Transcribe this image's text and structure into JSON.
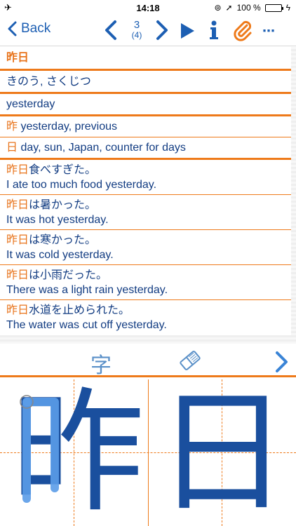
{
  "status": {
    "time": "14:18",
    "battery": "100 %"
  },
  "nav": {
    "back_label": "Back",
    "position": "3",
    "total": "(4)",
    "more": "⋯"
  },
  "entry": {
    "word": "昨日",
    "reading": "きのう, さくじつ",
    "meaning": "yesterday",
    "kanji": [
      {
        "char": "昨",
        "meaning": "yesterday, previous"
      },
      {
        "char": "日",
        "meaning": "day, sun, Japan, counter for days"
      }
    ],
    "examples": [
      {
        "word": "昨日",
        "rest": "食べすぎた。",
        "en": "I ate too much food yesterday."
      },
      {
        "word": "昨日",
        "rest": "は暑かった。",
        "en": "It was hot yesterday."
      },
      {
        "word": "昨日",
        "rest": "は寒かった。",
        "en": "It was cold yesterday."
      },
      {
        "word": "昨日",
        "rest": "は小雨だった。",
        "en": "There was a light rain yesterday."
      },
      {
        "word": "昨日",
        "rest": "水道を止められた。",
        "en": "The water was cut off yesterday."
      }
    ]
  },
  "tools": {
    "char_label": "字"
  },
  "pad": {
    "kanji1": "昨",
    "kanji2": "日"
  },
  "colors": {
    "accent": "#ee7a1a",
    "text": "#123c82",
    "nav": "#1d5fb3"
  }
}
